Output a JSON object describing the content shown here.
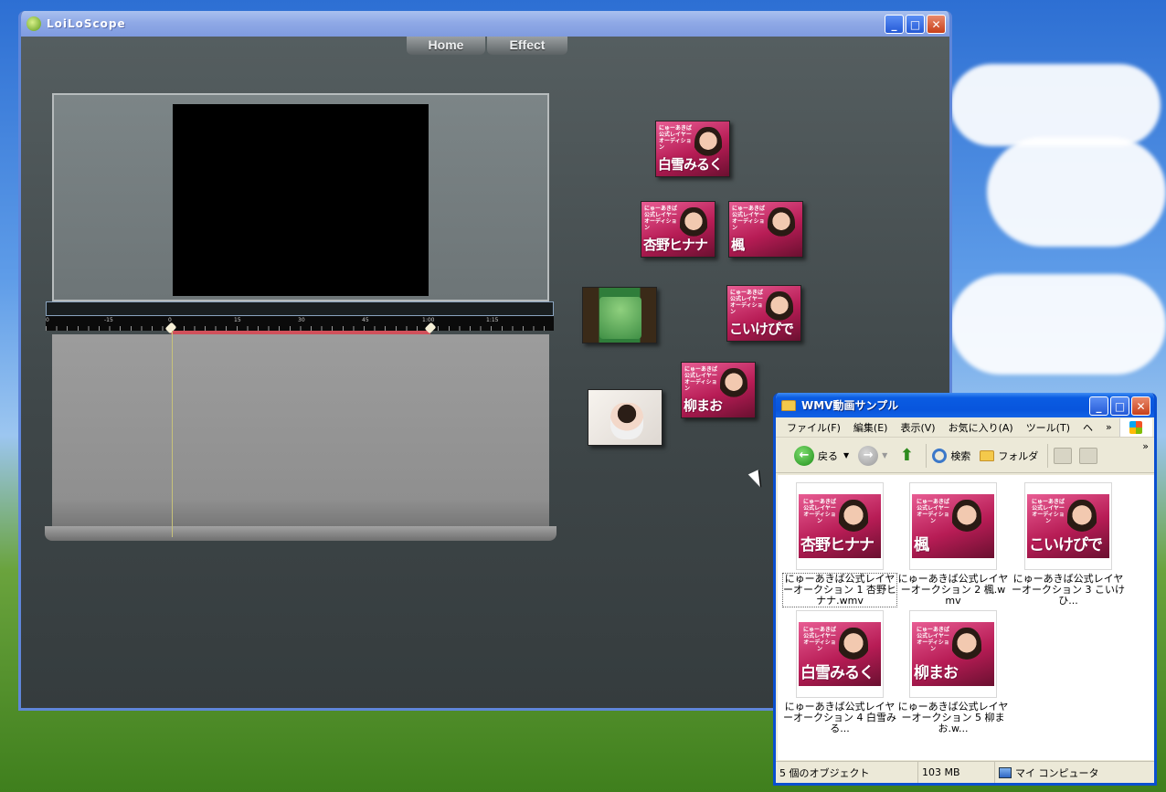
{
  "app": {
    "title": "LoiLoScope",
    "tabs": [
      "Home",
      "Effect"
    ],
    "ruler_labels": [
      "0",
      "-15",
      "0",
      "15",
      "30",
      "45",
      "1:00",
      "1:15"
    ],
    "thumbnails": [
      {
        "caption": "にゅーあきば公式レイヤーオーディション",
        "name": "白雪みるく"
      },
      {
        "caption": "にゅーあきば公式レイヤーオーディション",
        "name": "杏野ヒナナ"
      },
      {
        "caption": "にゅーあきば公式レイヤーオーディション",
        "name": "楓"
      },
      {
        "caption": "にゅーあきば公式レイヤーオーディション",
        "name": "こいけぴで"
      },
      {
        "caption": "にゅーあきば公式レイヤーオーディション",
        "name": "柳まお"
      }
    ]
  },
  "explorer": {
    "title": "WMV動画サンプル",
    "menu": [
      "ファイル(F)",
      "編集(E)",
      "表示(V)",
      "お気に入り(A)",
      "ツール(T)",
      "ヘ"
    ],
    "toolbar": {
      "back": "戻る",
      "search": "検索",
      "folders": "フォルダ"
    },
    "files": [
      {
        "label": "にゅーあきば公式レイヤーオークション 1 杏野ヒナナ.wmv",
        "name": "杏野ヒナナ"
      },
      {
        "label": "にゅーあきば公式レイヤーオークション 2 楓.wmv",
        "name": "楓"
      },
      {
        "label": "にゅーあきば公式レイヤーオークション 3 こいけひ...",
        "name": "こいけぴで"
      },
      {
        "label": "にゅーあきば公式レイヤーオークション 4 白雪みる...",
        "name": "白雪みるく"
      },
      {
        "label": "にゅーあきば公式レイヤーオークション 5 柳まお.w...",
        "name": "柳まお"
      }
    ],
    "thumb_caption": "にゅーあきば公式レイヤーオーディション",
    "status": {
      "objects": "5 個のオブジェクト",
      "size": "103 MB",
      "location": "マイ コンピュータ"
    }
  },
  "colors": {
    "accent_red": "#d0505a",
    "xp_blue": "#0a5ce2"
  }
}
